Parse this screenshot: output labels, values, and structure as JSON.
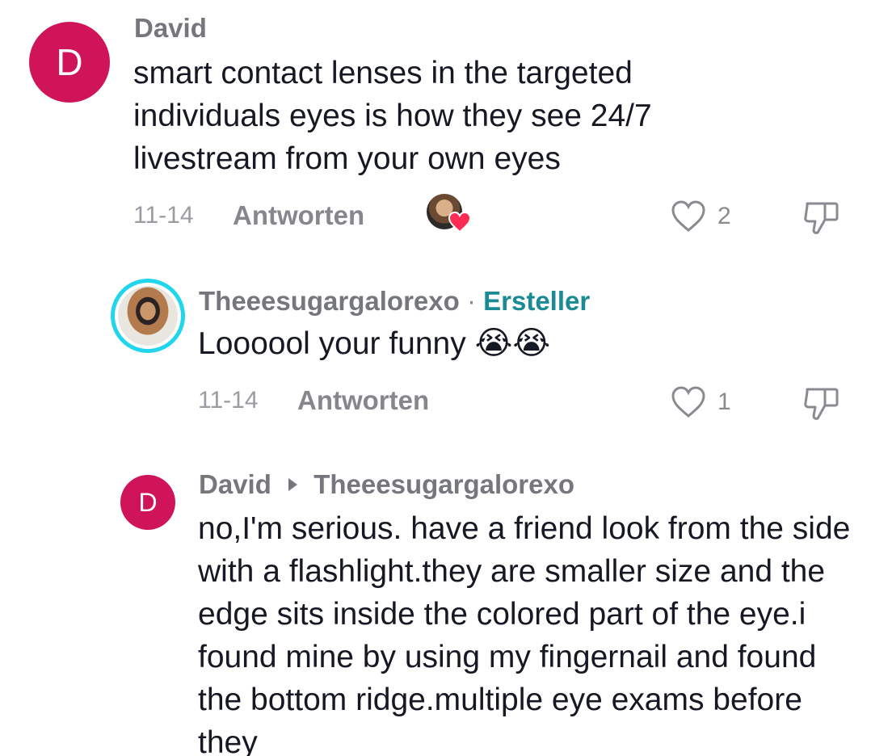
{
  "comments": [
    {
      "author": "David",
      "avatar_letter": "D",
      "text": "smart contact lenses in the targeted individuals eyes is how they see 24/7 livestream from your own eyes",
      "date": "11-14",
      "reply_label": "Antworten",
      "like_count": "2",
      "liked_by_creator": true
    },
    {
      "author": "Theeesugargalorexo",
      "separator": "·",
      "badge": "Ersteller",
      "text": "Loooool your funny",
      "emoji": "😭😭",
      "date": "11-14",
      "reply_label": "Antworten",
      "like_count": "1"
    },
    {
      "author": "David",
      "avatar_letter": "D",
      "reply_to": "Theeesugargalorexo",
      "text": "no,I'm serious. have a friend look from the side with a flashlight.they are smaller size and the edge sits inside the colored part of the eye.i found mine by using my fingernail and found the bottom ridge.multiple eye exams before they"
    }
  ],
  "colors": {
    "avatar_bg": "#d0145a",
    "creator_badge": "#1a8a96",
    "story_ring": "#20d5ec",
    "like_heart": "#fe2c55"
  },
  "icons": [
    "heart-outline-icon",
    "thumbs-down-icon",
    "creator-liked-heart-icon",
    "reply-arrow-icon"
  ]
}
